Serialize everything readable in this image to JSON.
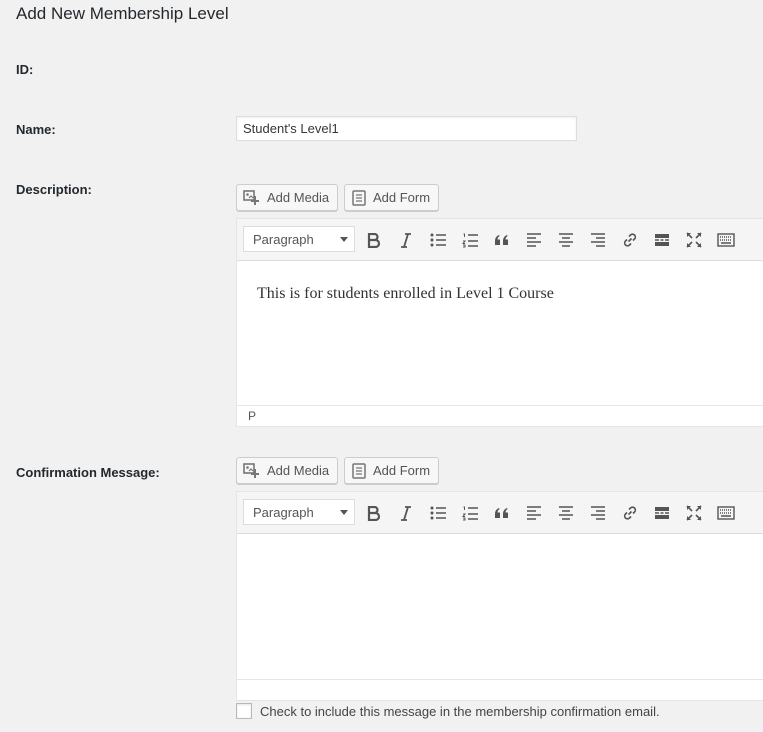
{
  "page": {
    "title": "Add New Membership Level"
  },
  "fields": {
    "id_label": "ID:",
    "name_label": "Name:",
    "name_value": "Student's Level1",
    "description_label": "Description:",
    "confirmation_label": "Confirmation Message:"
  },
  "media_buttons": {
    "add_media": "Add Media",
    "add_form": "Add Form"
  },
  "editor": {
    "format_value": "Paragraph",
    "toolbar_icons": [
      "bold-icon",
      "italic-icon",
      "bullet-list-icon",
      "numbered-list-icon",
      "blockquote-icon",
      "align-left-icon",
      "align-center-icon",
      "align-right-icon",
      "link-icon",
      "read-more-icon",
      "fullscreen-icon",
      "toolbar-toggle-icon"
    ]
  },
  "description_editor": {
    "content": "This is for students enrolled in Level 1 Course",
    "path": "P"
  },
  "confirmation_editor": {
    "content": ""
  },
  "confirmation_email": {
    "label": "Check to include this message in the membership confirmation email.",
    "checked": false
  },
  "colors": {
    "background": "#f1f1f1",
    "text": "#23282d",
    "border": "#dddddd",
    "icon": "#555555"
  }
}
